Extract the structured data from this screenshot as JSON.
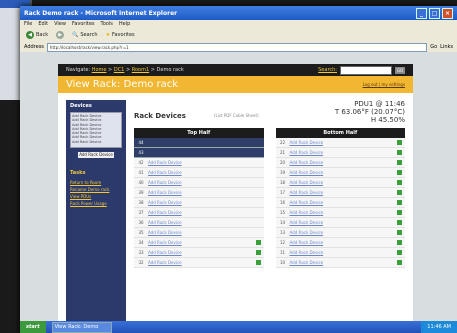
{
  "window": {
    "title": "Rack Demo rack - Microsoft Internet Explorer",
    "controls": [
      "_",
      "□",
      "×"
    ]
  },
  "menu": [
    "File",
    "Edit",
    "View",
    "Favorites",
    "Tools",
    "Help"
  ],
  "toolbar": {
    "back": "Back",
    "search": "Search",
    "favorites": "Favorites"
  },
  "address": {
    "label": "Address",
    "url": "http://localhost/rack/view.rack.php?r=1",
    "go": "Go",
    "links": "Links"
  },
  "nav": {
    "prefix": "Navigate: ",
    "crumbs": [
      "Home",
      "DC1",
      "Room1",
      "Demo rack"
    ],
    "search_label": "Search:",
    "go": "GO"
  },
  "header": {
    "title": "View Rack: Demo rack",
    "link": "Log out | my settings"
  },
  "sidebar": {
    "devices_heading": "Devices",
    "devices": [
      "Add Rack Device",
      "Add Rack Device",
      "Add Rack Device",
      "Add Rack Device",
      "Add Rack Device",
      "Add Rack Device",
      "Add Rack Device"
    ],
    "button": "Add Rack Device",
    "tasks_heading": "Tasks",
    "tasks": [
      "Return to Room",
      "Rename Demo rack",
      "View PDUs",
      "Rack Power Usage"
    ]
  },
  "main": {
    "heading": "Rack Devices",
    "pdf_link": "(List PDF Cable Sheet)",
    "stats": [
      "PDU1 @ 11:46",
      "T 63.06°F (20.07°C)",
      "H 45.50%"
    ]
  },
  "rack": {
    "top_half": {
      "label": "Top Half",
      "rows": [
        {
          "num": "44",
          "device": "",
          "dark": true,
          "icon": false
        },
        {
          "num": "43",
          "device": "",
          "dark": true,
          "icon": false
        },
        {
          "num": "42",
          "device": "Add Rack Device",
          "dark": false,
          "icon": false
        },
        {
          "num": "41",
          "device": "Add Rack Device",
          "dark": false,
          "icon": false
        },
        {
          "num": "40",
          "device": "Add Rack Device",
          "dark": false,
          "icon": false
        },
        {
          "num": "39",
          "device": "Add Rack Device",
          "dark": false,
          "icon": false
        },
        {
          "num": "38",
          "device": "Add Rack Device",
          "dark": false,
          "icon": false
        },
        {
          "num": "37",
          "device": "Add Rack Device",
          "dark": false,
          "icon": false
        },
        {
          "num": "36",
          "device": "Add Rack Device",
          "dark": false,
          "icon": false
        },
        {
          "num": "35",
          "device": "Add Rack Device",
          "dark": false,
          "icon": false
        },
        {
          "num": "34",
          "device": "Add Rack Device",
          "dark": false,
          "icon": true
        },
        {
          "num": "33",
          "device": "Add Rack Device",
          "dark": false,
          "icon": true
        },
        {
          "num": "32",
          "device": "Add Rack Device",
          "dark": false,
          "icon": true
        }
      ]
    },
    "bottom_half": {
      "label": "Bottom Half",
      "rows": [
        {
          "num": "22",
          "device": "Add Rack Device",
          "dark": false,
          "icon": true
        },
        {
          "num": "21",
          "device": "Add Rack Device",
          "dark": false,
          "icon": true
        },
        {
          "num": "20",
          "device": "Add Rack Device",
          "dark": false,
          "icon": true
        },
        {
          "num": "19",
          "device": "Add Rack Device",
          "dark": false,
          "icon": true
        },
        {
          "num": "18",
          "device": "Add Rack Device",
          "dark": false,
          "icon": true
        },
        {
          "num": "17",
          "device": "Add Rack Device",
          "dark": false,
          "icon": true
        },
        {
          "num": "16",
          "device": "Add Rack Device",
          "dark": false,
          "icon": true
        },
        {
          "num": "15",
          "device": "Add Rack Device",
          "dark": false,
          "icon": true
        },
        {
          "num": "14",
          "device": "Add Rack Device",
          "dark": false,
          "icon": true
        },
        {
          "num": "13",
          "device": "Add Rack Device",
          "dark": false,
          "icon": true
        },
        {
          "num": "12",
          "device": "Add Rack Device",
          "dark": false,
          "icon": true
        },
        {
          "num": "11",
          "device": "Add Rack Device",
          "dark": false,
          "icon": true
        },
        {
          "num": "10",
          "device": "Add Rack Device",
          "dark": false,
          "icon": true
        }
      ]
    }
  },
  "taskbar": {
    "start": "start",
    "task": "View Rack: Demo rack",
    "tray_clock": "11:46 AM"
  },
  "colors": {
    "accent": "#f2b732",
    "sidebar": "#2b3a6a",
    "nav": "#1c1c1c"
  }
}
